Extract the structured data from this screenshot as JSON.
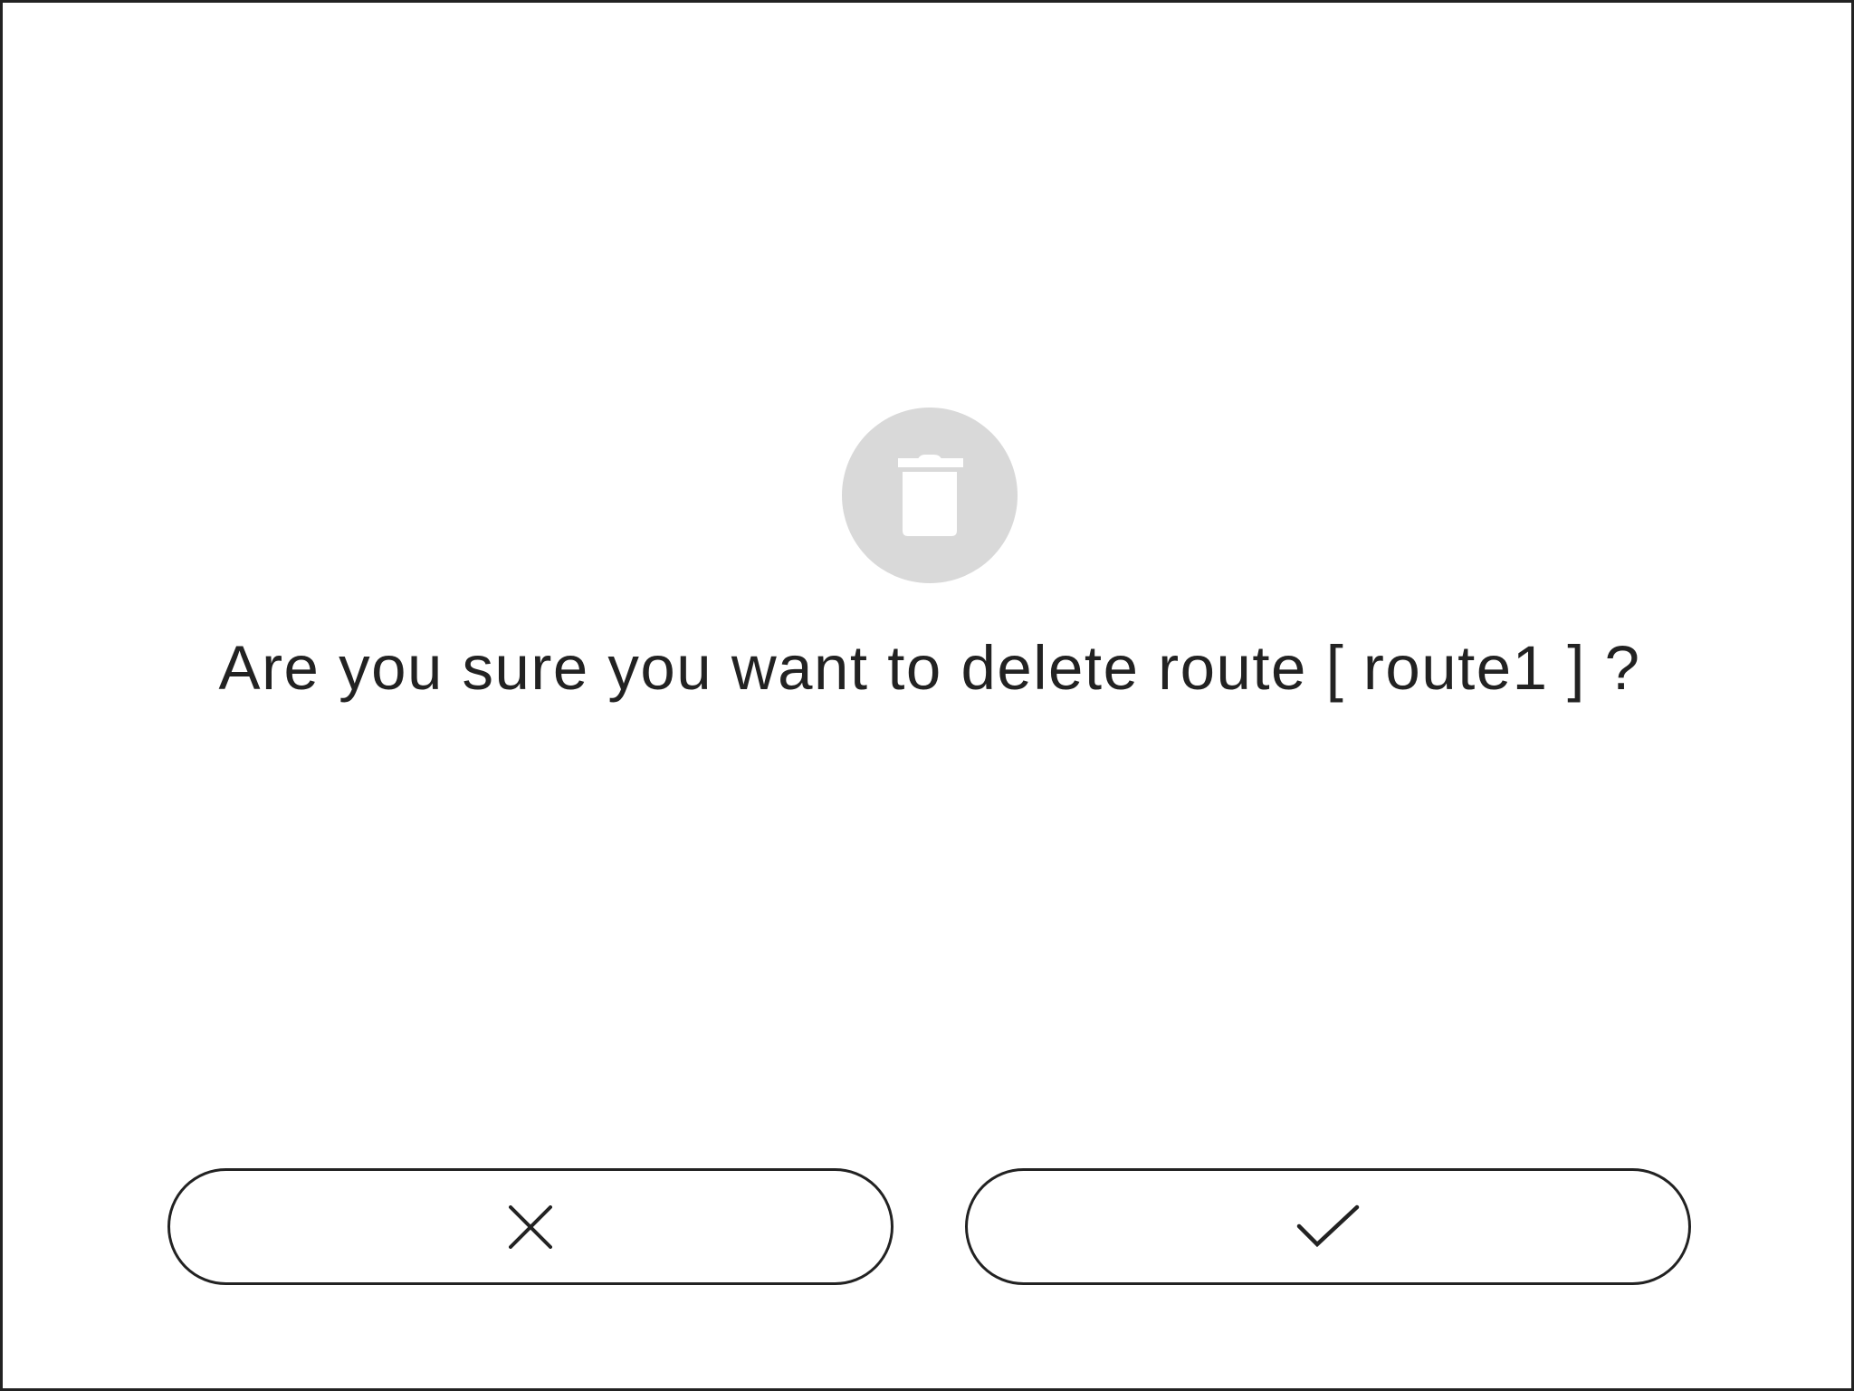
{
  "dialog": {
    "message": "Are you sure you want to delete route [ route1 ] ?",
    "icon": "trash-icon",
    "cancel_icon": "close-icon",
    "confirm_icon": "check-icon"
  },
  "colors": {
    "text": "#222222",
    "icon_circle": "#d9d9d9",
    "icon_glyph": "#ffffff",
    "border": "#222222",
    "background": "#ffffff"
  }
}
